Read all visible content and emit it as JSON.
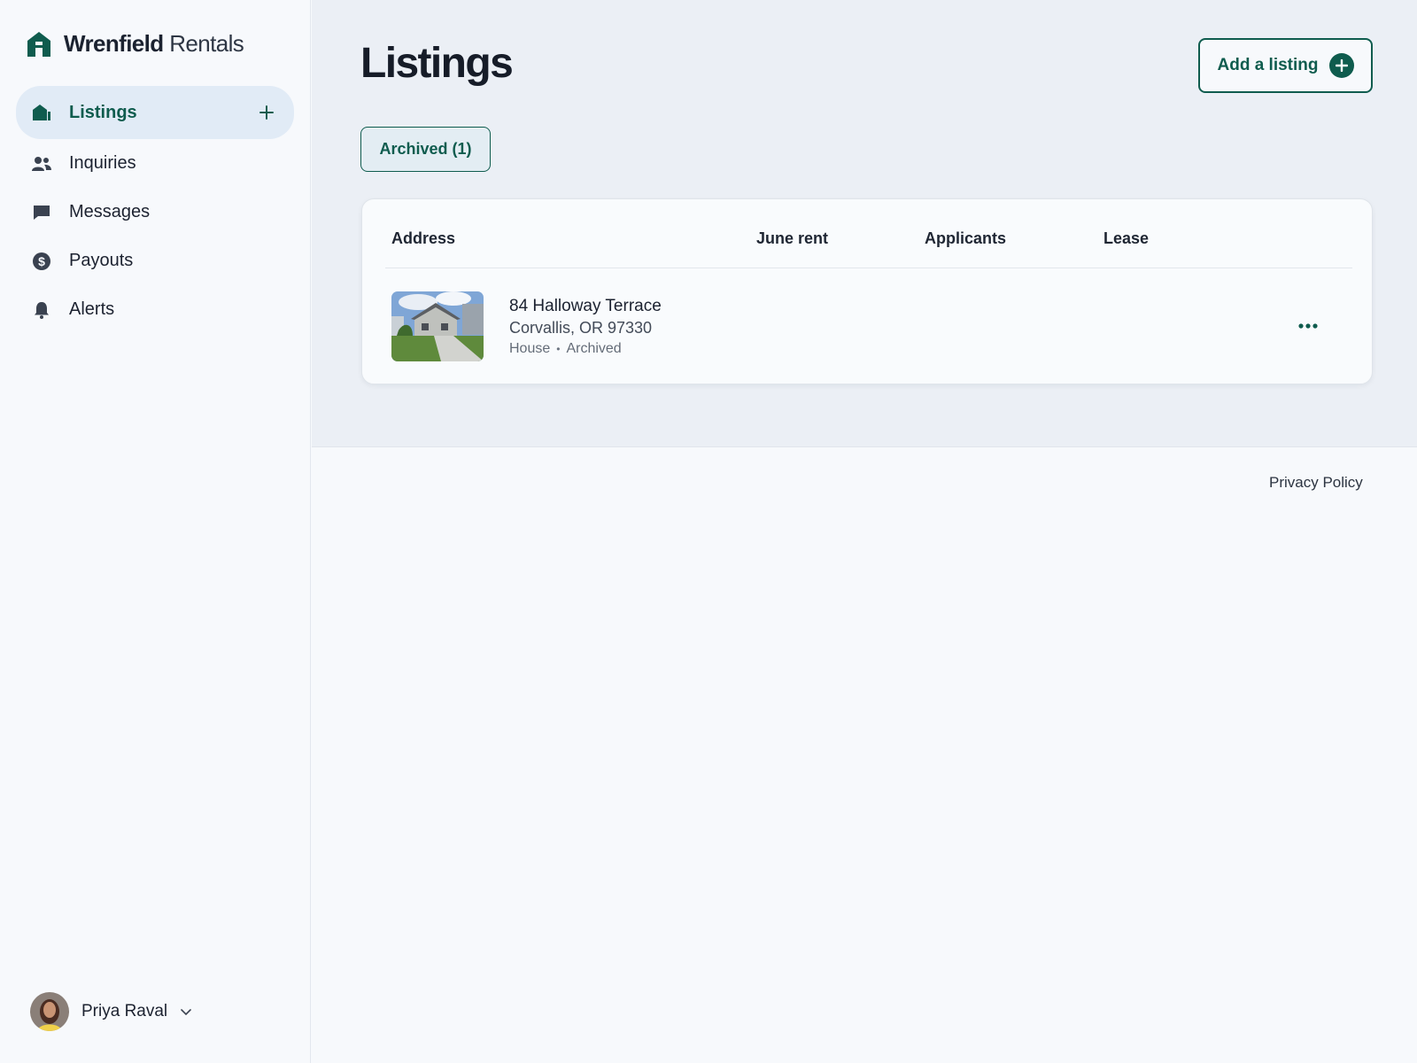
{
  "brand": {
    "name_strong": "Wrenfield",
    "name_light": "Rentals",
    "logo_icon": "house-logo-icon"
  },
  "sidebar": {
    "items": [
      {
        "label": "Listings",
        "icon": "home-icon",
        "active": true
      },
      {
        "label": "Inquiries",
        "icon": "people-icon",
        "active": false
      },
      {
        "label": "Messages",
        "icon": "chat-icon",
        "active": false
      },
      {
        "label": "Payouts",
        "icon": "dollar-icon",
        "active": false
      },
      {
        "label": "Alerts",
        "icon": "bell-icon",
        "active": false
      }
    ],
    "add_icon": "plus-icon"
  },
  "user": {
    "name": "Priya Raval"
  },
  "main": {
    "title": "Listings",
    "add_button": {
      "label": "Add a listing",
      "icon": "plus-circle-icon"
    },
    "filter_chip": "Archived (1)",
    "table": {
      "columns": [
        "Address",
        "June rent",
        "Applicants",
        "Lease"
      ],
      "rows": [
        {
          "street": "84 Halloway Terrace",
          "city": "Corvallis, OR 97330",
          "type": "House",
          "separator": "•",
          "status": "Archived",
          "rent": "",
          "applicants": "",
          "lease": ""
        }
      ]
    }
  },
  "footer": {
    "privacy_link": "Privacy Policy"
  },
  "colors": {
    "accent": "#0f5c4e",
    "active_nav_bg": "#e1ebf6",
    "main_bg": "#ebeff5",
    "sidebar_bg": "#f7f9fc"
  }
}
